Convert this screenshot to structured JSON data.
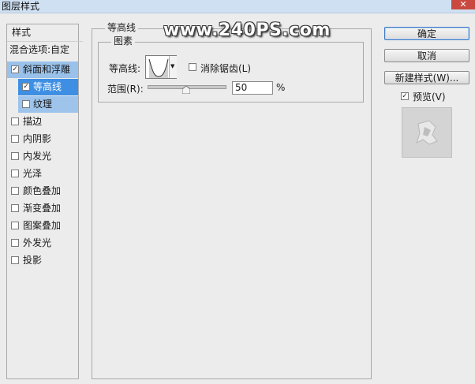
{
  "window": {
    "title": "图层样式",
    "close_label": "✕"
  },
  "sidebar": {
    "header": "样式",
    "items": [
      {
        "label": "混合选项:自定",
        "checked": null
      },
      {
        "label": "斜面和浮雕",
        "checked": true
      },
      {
        "label": "等高线",
        "checked": true
      },
      {
        "label": "纹理",
        "checked": false
      },
      {
        "label": "描边",
        "checked": false
      },
      {
        "label": "内阴影",
        "checked": false
      },
      {
        "label": "内发光",
        "checked": false
      },
      {
        "label": "光泽",
        "checked": false
      },
      {
        "label": "颜色叠加",
        "checked": false
      },
      {
        "label": "渐变叠加",
        "checked": false
      },
      {
        "label": "图案叠加",
        "checked": false
      },
      {
        "label": "外发光",
        "checked": false
      },
      {
        "label": "投影",
        "checked": false
      }
    ]
  },
  "panel": {
    "group_title": "等高线",
    "subgroup_title": "图素",
    "contour_label": "等高线:",
    "antialias_label": "消除锯齿(L)",
    "antialias_checked": false,
    "range_label": "范围(R):",
    "range_value": "50",
    "range_unit": "%",
    "range_fraction": 0.5
  },
  "watermark": "www.240PS.com",
  "buttons": {
    "ok": "确定",
    "cancel": "取消",
    "new_style": "新建样式(W)...",
    "preview_label": "预览(V)",
    "preview_checked": true
  },
  "colors": {
    "selected_row": "#99c1ea",
    "active_row": "#3e8fe3",
    "titlebar": "#cfe0f2"
  }
}
